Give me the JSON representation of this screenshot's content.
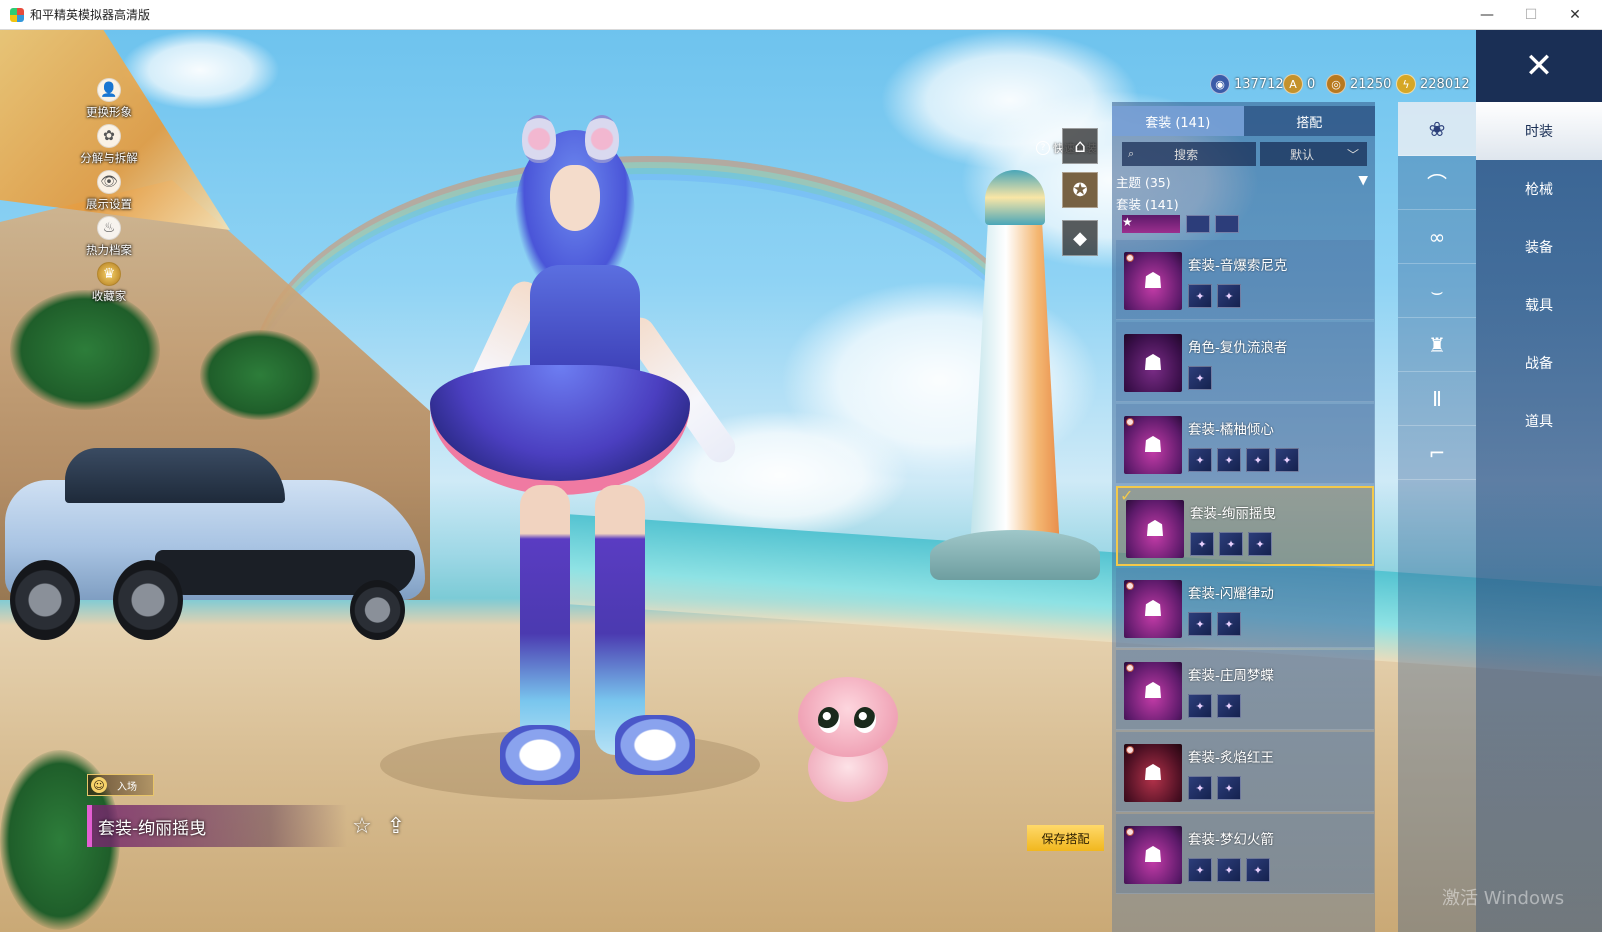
{
  "window": {
    "title": "和平精英模拟器高清版",
    "minimize": "—",
    "maximize": "☐",
    "close": "✕"
  },
  "left_menu": [
    {
      "label": "更换形象",
      "icon": "👤"
    },
    {
      "label": "分解与拆解",
      "icon": "✿"
    },
    {
      "label": "展示设置",
      "icon": "👁"
    },
    {
      "label": "热力档案",
      "icon": "♨"
    },
    {
      "label": "收藏家",
      "icon": "♛"
    }
  ],
  "entry_badge": "入场",
  "current_outfit": "套装-绚丽摇曳",
  "quick_change": {
    "label": "快速换装",
    "help": "?"
  },
  "currencies": [
    {
      "name": "currency-1",
      "value": "137712",
      "color": "#3b5ba8"
    },
    {
      "name": "currency-2",
      "value": "0",
      "color": "#c4922c"
    },
    {
      "name": "currency-3",
      "value": "21250",
      "color": "#b8791f"
    },
    {
      "name": "currency-4",
      "value": "228012",
      "color": "#d6a726"
    }
  ],
  "tabs": [
    "套装 (141)",
    "搭配"
  ],
  "search": {
    "placeholder": "搜索",
    "icon": "🔍"
  },
  "sort": {
    "value": "默认",
    "arrow": "﹀"
  },
  "filters": {
    "theme": "主题 (35)",
    "theme_arrow": "▼",
    "suits": "套装 (141)"
  },
  "items": [
    {
      "name": "套装-音爆索尼克",
      "parts": 2,
      "selected": false
    },
    {
      "name": "角色-复仇流浪者",
      "parts": 1,
      "selected": false
    },
    {
      "name": "套装-橘柚倾心",
      "parts": 4,
      "selected": false
    },
    {
      "name": "套装-绚丽摇曳",
      "parts": 3,
      "selected": true
    },
    {
      "name": "套装-闪耀律动",
      "parts": 2,
      "selected": false
    },
    {
      "name": "套装-庄周梦蝶",
      "parts": 2,
      "selected": false
    },
    {
      "name": "套装-炙焰红王",
      "parts": 2,
      "selected": false
    },
    {
      "name": "套装-梦幻火箭",
      "parts": 3,
      "selected": false
    }
  ],
  "categories": [
    "时装",
    "枪械",
    "装备",
    "载具",
    "战备",
    "道具"
  ],
  "sub_icons": [
    "outfit-icon",
    "hat-icon",
    "glasses-icon",
    "necklace-icon",
    "top-icon",
    "pants-icon",
    "shoes-icon"
  ],
  "save_button": "保存搭配",
  "watermark": "激活 Windows"
}
